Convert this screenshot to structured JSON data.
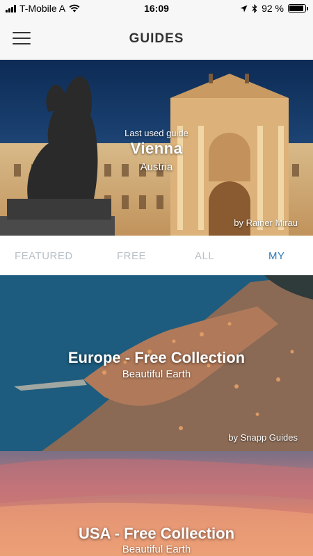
{
  "status_bar": {
    "carrier": "T-Mobile A",
    "time": "16:09",
    "battery_percent": "92 %",
    "battery_level": 0.92
  },
  "nav": {
    "title": "GUIDES",
    "menu_icon": "hamburger-menu-icon"
  },
  "hero": {
    "caption": "Last used guide",
    "title": "Vienna",
    "country": "Austria",
    "credit": "by Rainer Mirau"
  },
  "tabs": [
    {
      "label": "FEATURED",
      "active": false
    },
    {
      "label": "FREE",
      "active": false
    },
    {
      "label": "ALL",
      "active": false
    },
    {
      "label": "MY",
      "active": true
    }
  ],
  "cards": [
    {
      "title": "Europe - Free Collection",
      "subtitle": "Beautiful Earth",
      "credit": "by Snapp Guides"
    },
    {
      "title": "USA - Free Collection",
      "subtitle": "Beautiful Earth",
      "credit": ""
    }
  ],
  "colors": {
    "accent": "#2e7bb7",
    "tab_inactive": "#b8c0c7",
    "nav_bg": "#f7f7f7"
  }
}
